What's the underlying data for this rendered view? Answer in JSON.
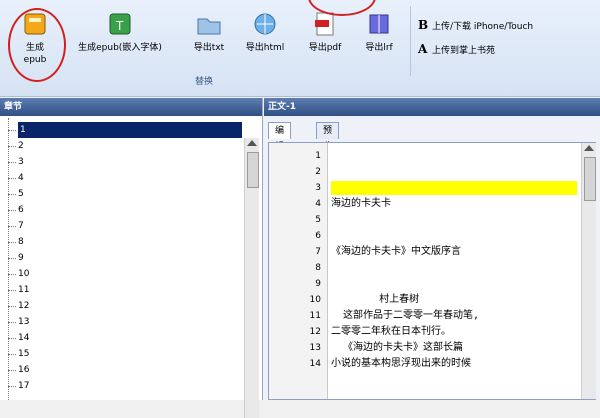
{
  "ribbon": {
    "tools": [
      {
        "label": "生成\nepub",
        "icon": "book-icon"
      },
      {
        "label": "生成epub(嵌入字体)",
        "icon": "book-font-icon"
      },
      {
        "label": "导出txt",
        "icon": "folder-icon"
      },
      {
        "label": "导出html",
        "icon": "globe-icon"
      },
      {
        "label": "导出pdf",
        "icon": "pdf-icon"
      },
      {
        "label": "导出lrf",
        "icon": "lrf-book-icon"
      }
    ],
    "group_caption": "替换",
    "right": [
      {
        "letter": "B",
        "label": "上传/下载 iPhone/Touch"
      },
      {
        "letter": "A",
        "label": "上传到掌上书苑"
      }
    ]
  },
  "left_panel": {
    "title": "章节",
    "items": [
      "1",
      "2",
      "3",
      "4",
      "5",
      "6",
      "7",
      "8",
      "9",
      "10",
      "11",
      "12",
      "13",
      "14",
      "15",
      "16",
      "17"
    ],
    "selected_index": 0
  },
  "right_panel": {
    "title": "正文-1",
    "tabs": [
      "编辑",
      "预览"
    ],
    "active_tab": 0,
    "lines": [
      {
        "n": "1",
        "text": ""
      },
      {
        "n": "2",
        "text": ""
      },
      {
        "n": "3",
        "text": "",
        "highlight": true
      },
      {
        "n": "4",
        "text": "海边的卡夫卡"
      },
      {
        "n": "5",
        "text": ""
      },
      {
        "n": "6",
        "text": ""
      },
      {
        "n": "7",
        "text": "《海边的卡夫卡》中文版序言"
      },
      {
        "n": "8",
        "text": ""
      },
      {
        "n": "9",
        "text": ""
      },
      {
        "n": "10",
        "text": "        村上春树"
      },
      {
        "n": "11",
        "text": "  这部作品于二零零一年春动笔,"
      },
      {
        "n": "12",
        "text": "二零零二年秋在日本刊行。"
      },
      {
        "n": "13",
        "text": "  《海边的卡夫卡》这部长篇"
      },
      {
        "n": "14",
        "text": "小说的基本构思浮现出来的时候"
      }
    ]
  },
  "colors": {
    "accent": "#2f4f86",
    "highlight": "#ffff00",
    "annotation": "#d21f1f"
  }
}
